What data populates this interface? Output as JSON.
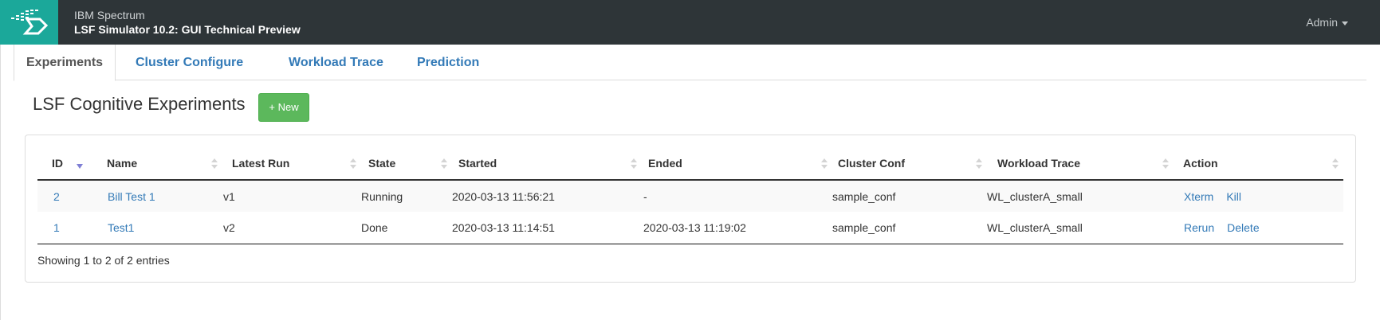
{
  "header": {
    "brand_line1": "IBM Spectrum",
    "brand_line2": "LSF Simulator 10.2: GUI Technical Preview",
    "user_menu": "Admin",
    "logo_icon": "ibm-spectrum-logo-icon",
    "logo_color": "#1ba89a",
    "bar_color": "#2e3538"
  },
  "tabs": [
    {
      "label": "Experiments",
      "active": true
    },
    {
      "label": "Cluster Configure",
      "active": false
    },
    {
      "label": "Workload Trace",
      "active": false
    },
    {
      "label": "Prediction",
      "active": false
    }
  ],
  "page": {
    "title": "LSF Cognitive Experiments",
    "new_button": "+ New",
    "new_button_color": "#5cb85c"
  },
  "table": {
    "columns": [
      "ID",
      "Name",
      "Latest Run",
      "State",
      "Started",
      "Ended",
      "Cluster Conf",
      "Workload Trace",
      "Action"
    ],
    "sorted_column": "ID",
    "sort_direction": "descending",
    "rows": [
      {
        "id": "2",
        "name": "Bill Test 1",
        "latest_run": "v1",
        "state": "Running",
        "started": "2020-03-13 11:56:21",
        "ended": "-",
        "cluster_conf": "sample_conf",
        "workload_trace": "WL_clusterA_small",
        "actions": [
          "Xterm",
          "Kill"
        ]
      },
      {
        "id": "1",
        "name": "Test1",
        "latest_run": "v2",
        "state": "Done",
        "started": "2020-03-13 11:14:51",
        "ended": "2020-03-13 11:19:02",
        "cluster_conf": "sample_conf",
        "workload_trace": "WL_clusterA_small",
        "actions": [
          "Rerun",
          "Delete"
        ]
      }
    ],
    "info": "Showing 1 to 2 of 2 entries"
  }
}
